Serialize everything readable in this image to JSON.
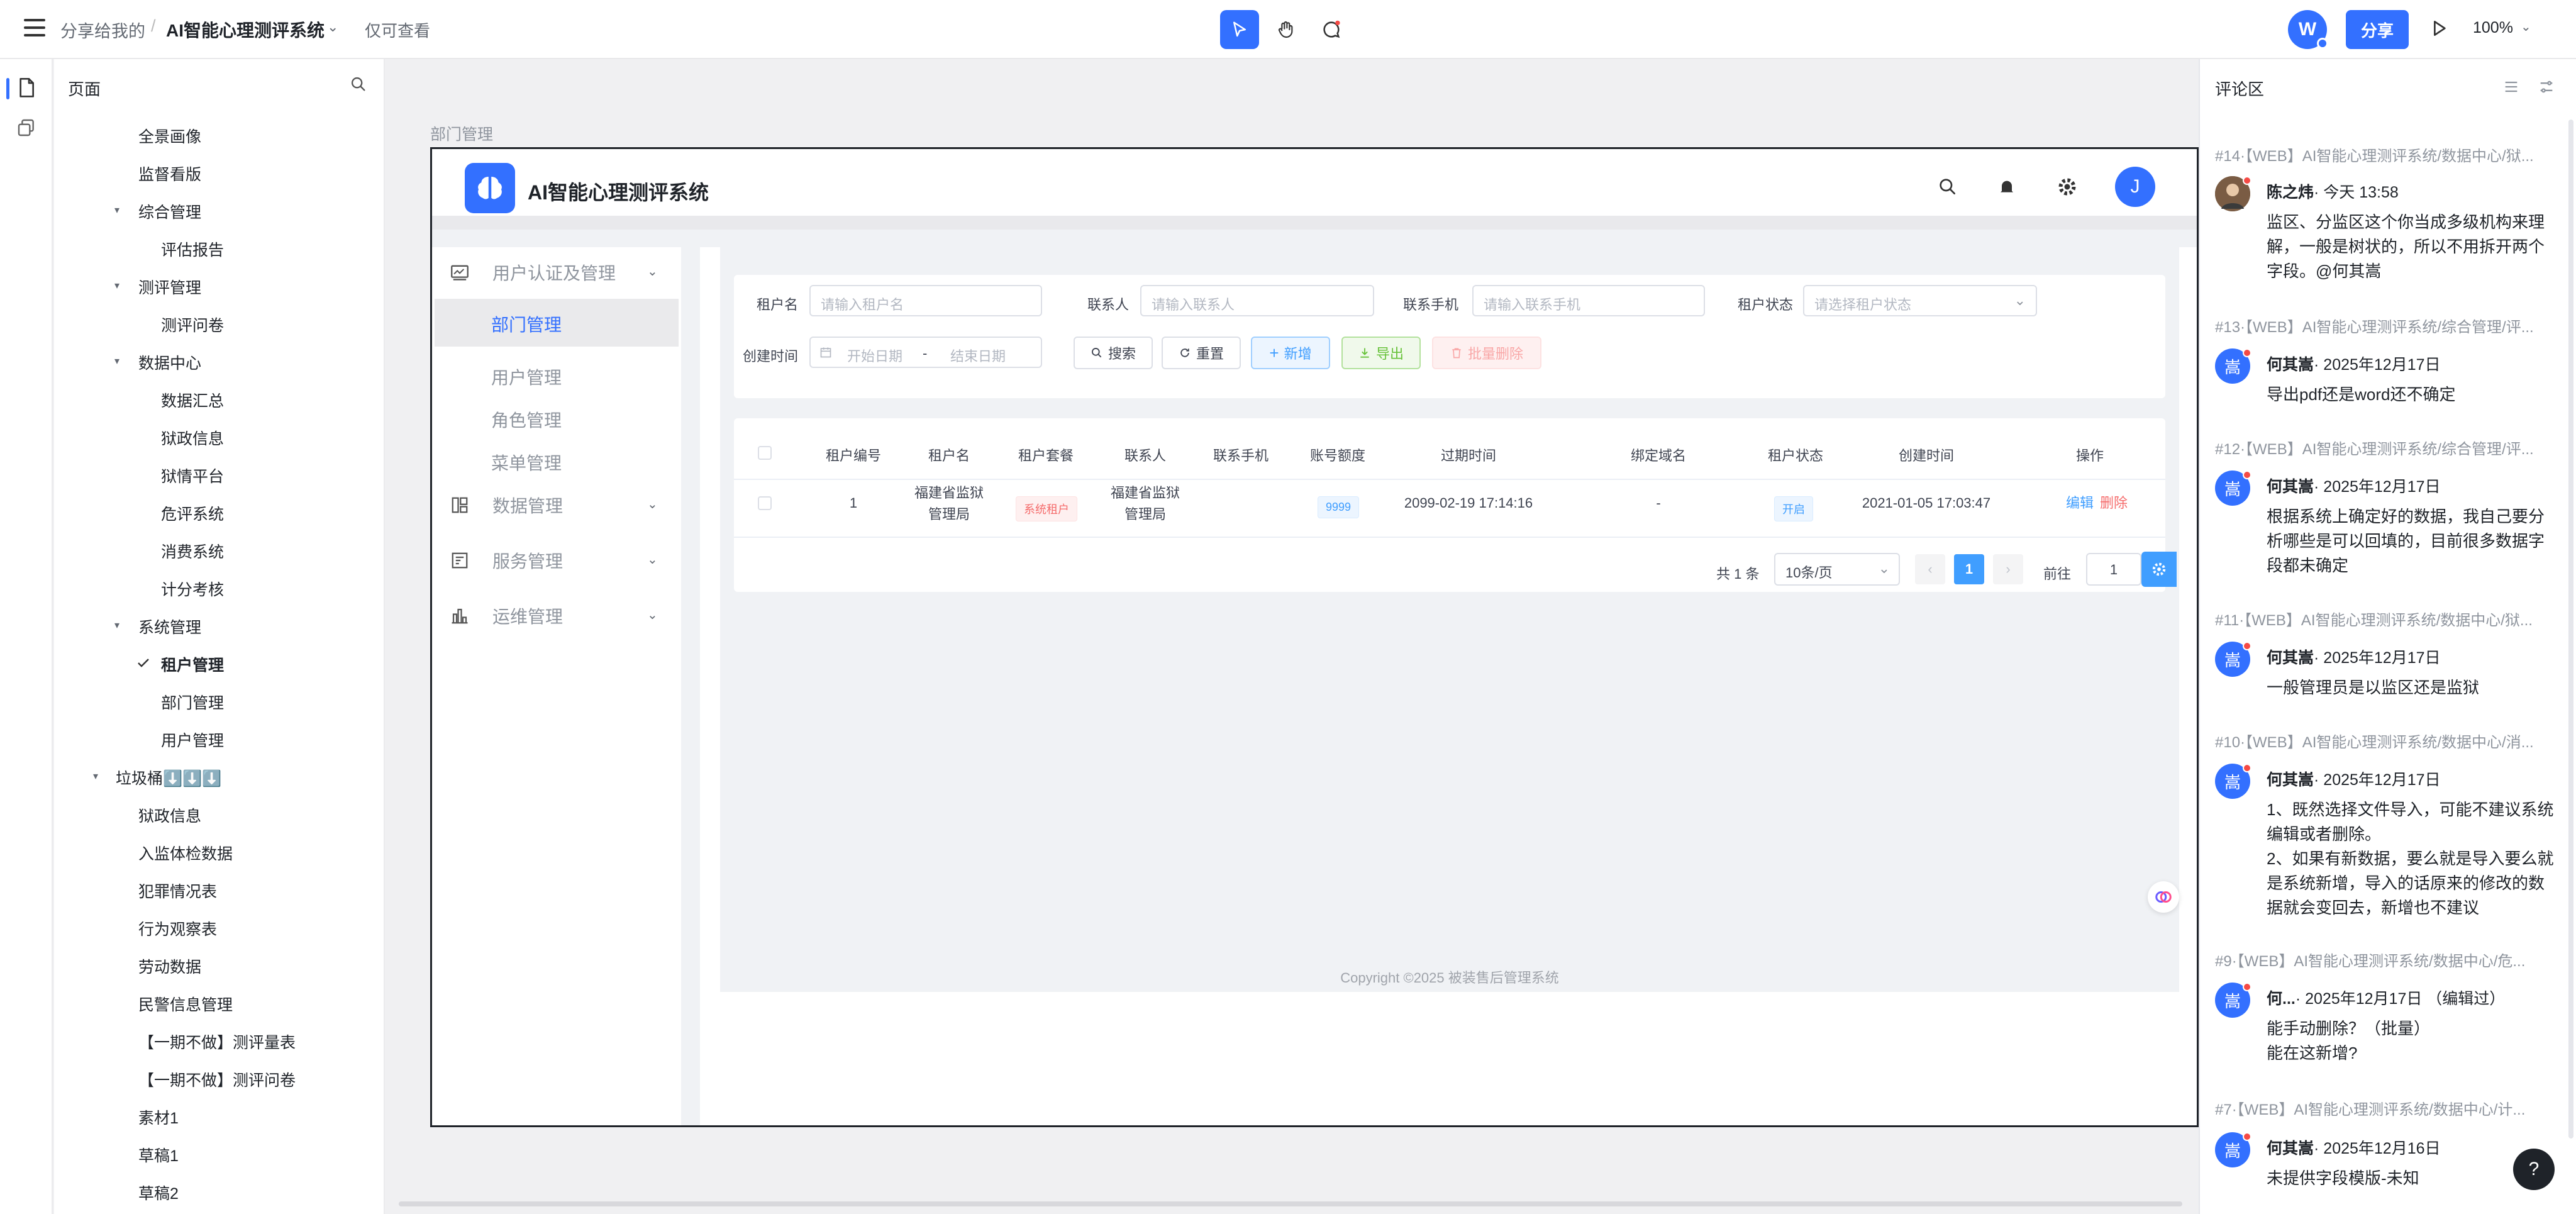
{
  "topbar": {
    "breadcrumb_root": "分享给我的",
    "separator": "/",
    "project_name": "AI智能心理测评系统",
    "view_mode": "仅可查看",
    "user_initial": "W",
    "share_label": "分享",
    "zoom": "100%"
  },
  "pages_panel": {
    "title": "页面",
    "items": [
      "全景画像",
      "监督看版",
      "综合管理",
      "评估报告",
      "测评管理",
      "测评问卷",
      "数据中心",
      "数据汇总",
      "狱政信息",
      "狱情平台",
      "危评系统",
      "消费系统",
      "计分考核",
      "系统管理",
      "租户管理",
      "部门管理",
      "用户管理",
      "垃圾桶⬇️⬇️⬇️",
      "狱政信息",
      "入监体检数据",
      "犯罪情况表",
      "行为观察表",
      "劳动数据",
      "民警信息管理",
      "【一期不做】测评量表",
      "【一期不做】测评问卷",
      "素材1",
      "草稿1",
      "草稿2"
    ]
  },
  "canvas": {
    "frame_label": "部门管理"
  },
  "app": {
    "title": "AI智能心理测评系统",
    "avatar_initial": "J",
    "sidebar": {
      "groups": [
        "用户认证及管理",
        "数据管理",
        "服务管理",
        "运维管理"
      ],
      "active_item": "部门管理",
      "sub_items": [
        "用户管理",
        "角色管理",
        "菜单管理"
      ]
    },
    "filters": {
      "tenant_name_label": "租户名",
      "tenant_name_placeholder": "请输入租户名",
      "contact_label": "联系人",
      "contact_placeholder": "请输入联系人",
      "phone_label": "联系手机",
      "phone_placeholder": "请输入联系手机",
      "status_label": "租户状态",
      "status_placeholder": "请选择租户状态",
      "created_label": "创建时间",
      "start_placeholder": "开始日期",
      "range_sep": "-",
      "end_placeholder": "结束日期"
    },
    "buttons": {
      "search": "搜索",
      "reset": "重置",
      "add": "新增",
      "export": "导出",
      "batch_delete": "批量删除"
    },
    "table": {
      "columns": [
        "租户编号",
        "租户名",
        "租户套餐",
        "联系人",
        "联系手机",
        "账号额度",
        "过期时间",
        "绑定域名",
        "租户状态",
        "创建时间",
        "操作"
      ],
      "row": {
        "id": "1",
        "name_line1": "福建省监狱",
        "name_line2": "管理局",
        "package": "系统租户",
        "contact_line1": "福建省监狱",
        "contact_line2": "管理局",
        "phone": "",
        "quota": "9999",
        "expire": "2099-02-19 17:14:16",
        "domain": "-",
        "status": "开启",
        "created": "2021-01-05 17:03:47",
        "edit": "编辑",
        "delete": "删除"
      }
    },
    "pager": {
      "total": "共 1 条",
      "page_size": "10条/页",
      "current_page": "1",
      "goto_label": "前往",
      "goto_value": "1"
    },
    "copyright": "Copyright ©2025 被装售后管理系统"
  },
  "comments": {
    "title": "评论区",
    "items": [
      {
        "header": "#14·【WEB】AI智能心理测评系统/数据中心/狱...",
        "avatar": "",
        "author": "陈之炜",
        "time": "· 今天 13:58",
        "body": "监区、分监区这个你当成多级机构来理解，一般是树状的，所以不用拆开两个字段。@何其嵩"
      },
      {
        "header": "#13·【WEB】AI智能心理测评系统/综合管理/评...",
        "avatar": "嵩",
        "author": "何其嵩",
        "time": "· 2025年12月17日",
        "body": "导出pdf还是word还不确定"
      },
      {
        "header": "#12·【WEB】AI智能心理测评系统/综合管理/评...",
        "avatar": "嵩",
        "author": "何其嵩",
        "time": "· 2025年12月17日",
        "body": "根据系统上确定好的数据，我自己要分析哪些是可以回填的，目前很多数据字段都未确定"
      },
      {
        "header": "#11·【WEB】AI智能心理测评系统/数据中心/狱...",
        "avatar": "嵩",
        "author": "何其嵩",
        "time": "· 2025年12月17日",
        "body": "一般管理员是以监区还是监狱"
      },
      {
        "header": "#10·【WEB】AI智能心理测评系统/数据中心/消...",
        "avatar": "嵩",
        "author": "何其嵩",
        "time": "· 2025年12月17日",
        "body": "1、既然选择文件导入，可能不建议系统编辑或者删除。\n2、如果有新数据，要么就是导入要么就是系统新增，导入的话原来的修改的数据就会变回去，新增也不建议"
      },
      {
        "header": "#9·【WEB】AI智能心理测评系统/数据中心/危...",
        "avatar": "嵩",
        "author": "何...",
        "time": "· 2025年12月17日 （编辑过）",
        "body": "能手动删除？（批量）\n能在这新增?"
      },
      {
        "header": "#7·【WEB】AI智能心理测评系统/数据中心/计...",
        "avatar": "嵩",
        "author": "何其嵩",
        "time": "· 2025年12月16日",
        "body": "未提供字段模版-未知"
      }
    ]
  },
  "help_label": "?",
  "colors": {
    "accent": "#3370ff",
    "danger": "#f54a45",
    "success": "#67c23a"
  }
}
